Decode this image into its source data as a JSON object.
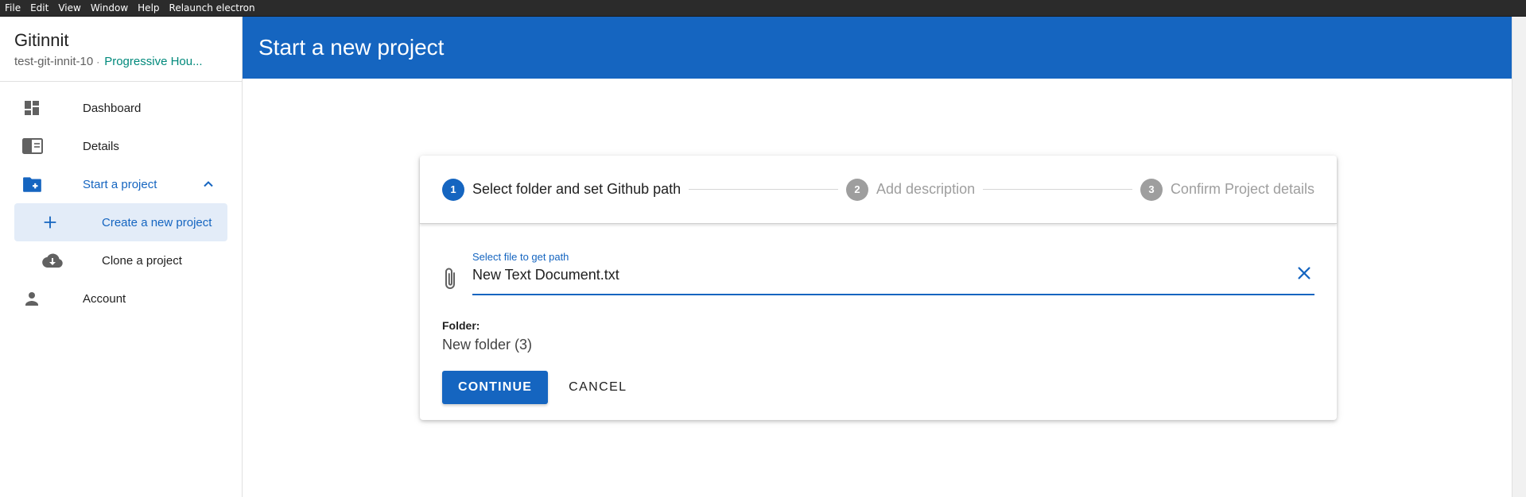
{
  "menubar": {
    "items": [
      "File",
      "Edit",
      "View",
      "Window",
      "Help",
      "Relaunch electron"
    ]
  },
  "app": {
    "title": "Gitinnit",
    "user": "test-git-innit-10",
    "separator": "·",
    "organization": "Progressive Hou..."
  },
  "sidebar": {
    "items": [
      {
        "label": "Dashboard",
        "icon": "dashboard-icon"
      },
      {
        "label": "Details",
        "icon": "details-icon"
      },
      {
        "label": "Start a project",
        "icon": "folder-add-icon"
      },
      {
        "label": "Create a new project",
        "icon": "plus-icon"
      },
      {
        "label": "Clone a project",
        "icon": "cloud-download-icon"
      },
      {
        "label": "Account",
        "icon": "person-icon"
      }
    ]
  },
  "header": {
    "title": "Start a new project"
  },
  "stepper": {
    "steps": [
      {
        "number": "1",
        "label": "Select folder and set Github path",
        "state": "active"
      },
      {
        "number": "2",
        "label": "Add description",
        "state": "inactive"
      },
      {
        "number": "3",
        "label": "Confirm Project details",
        "state": "inactive"
      }
    ]
  },
  "form": {
    "file_field_label": "Select file to get path",
    "file_field_value": "New Text Document.txt",
    "folder_label": "Folder:",
    "folder_value": "New folder (3)"
  },
  "actions": {
    "continue_label": "CONTINUE",
    "cancel_label": "CANCEL"
  },
  "colors": {
    "primary": "#1565c0",
    "org_text": "#00897b",
    "inactive_step": "#9e9e9e",
    "selected_bg": "#e3ecf8"
  }
}
